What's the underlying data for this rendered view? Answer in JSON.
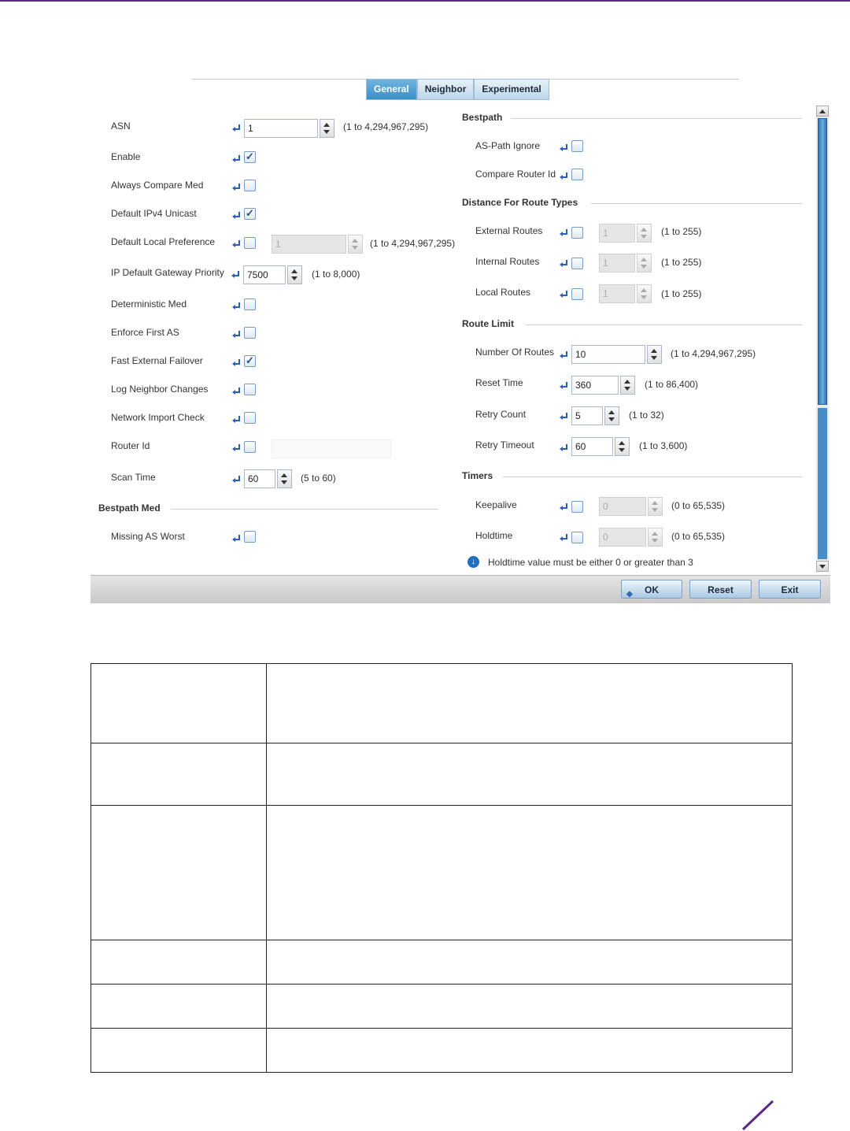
{
  "tabs": [
    "General",
    "Neighbor",
    "Experimental"
  ],
  "active_tab": "General",
  "left_fields": [
    {
      "label": "ASN",
      "control": "spinner",
      "value": "1",
      "range": "(1 to 4,294,967,295)"
    },
    {
      "label": "Enable",
      "control": "checkbox",
      "checked": true
    },
    {
      "label": "Always Compare Med",
      "control": "checkbox",
      "checked": false
    },
    {
      "label": "Default IPv4 Unicast",
      "control": "checkbox",
      "checked": true
    },
    {
      "label": "Default Local Preference",
      "control": "checkbox+spinner",
      "checked": false,
      "value": "1",
      "range": "(1 to 4,294,967,295)",
      "disabled": true
    },
    {
      "label": "IP Default Gateway Priority",
      "control": "spinner",
      "value": "7500",
      "range": "(1 to 8,000)"
    },
    {
      "label": "Deterministic Med",
      "control": "checkbox",
      "checked": false
    },
    {
      "label": "Enforce First AS",
      "control": "checkbox",
      "checked": false
    },
    {
      "label": "Fast External Failover",
      "control": "checkbox",
      "checked": true
    },
    {
      "label": "Log Neighbor Changes",
      "control": "checkbox",
      "checked": false
    },
    {
      "label": "Network Import Check",
      "control": "checkbox",
      "checked": false
    },
    {
      "label": "Router Id",
      "control": "checkbox+text",
      "checked": false
    },
    {
      "label": "Scan Time",
      "control": "spinner",
      "value": "60",
      "range": "(5 to 60)"
    }
  ],
  "bestpath_med": {
    "title": "Bestpath Med",
    "fields": [
      {
        "label": "Missing AS Worst",
        "checked": false
      }
    ]
  },
  "bestpath": {
    "title": "Bestpath",
    "fields": [
      {
        "label": "AS-Path Ignore",
        "checked": false
      },
      {
        "label": "Compare Router Id",
        "checked": false
      }
    ]
  },
  "distance": {
    "title": "Distance For Route Types",
    "fields": [
      {
        "label": "External Routes",
        "checked": false,
        "value": "1",
        "range": "(1 to 255)"
      },
      {
        "label": "Internal Routes",
        "checked": false,
        "value": "1",
        "range": "(1 to 255)"
      },
      {
        "label": "Local Routes",
        "checked": false,
        "value": "1",
        "range": "(1 to 255)"
      }
    ]
  },
  "route_limit": {
    "title": "Route Limit",
    "fields": [
      {
        "label": "Number Of Routes",
        "value": "10",
        "range": "(1 to 4,294,967,295)"
      },
      {
        "label": "Reset Time",
        "value": "360",
        "range": "(1 to 86,400)"
      },
      {
        "label": "Retry Count",
        "value": "5",
        "range": "(1 to 32)"
      },
      {
        "label": "Retry Timeout",
        "value": "60",
        "range": "(1 to 3,600)"
      }
    ]
  },
  "timers": {
    "title": "Timers",
    "fields": [
      {
        "label": "Keepalive",
        "checked": false,
        "value": "0",
        "range": "(0 to 65,535)"
      },
      {
        "label": "Holdtime",
        "checked": false,
        "value": "0",
        "range": "(0 to 65,535)"
      }
    ],
    "note": "Holdtime value must be either 0 or greater than 3"
  },
  "buttons": {
    "ok": "OK",
    "reset": "Reset",
    "exit": "Exit"
  },
  "colors": {
    "brand_rule": "#5b2a86",
    "tab_active": "#3a8fc8",
    "pin_icon": "#2d5fb0"
  }
}
